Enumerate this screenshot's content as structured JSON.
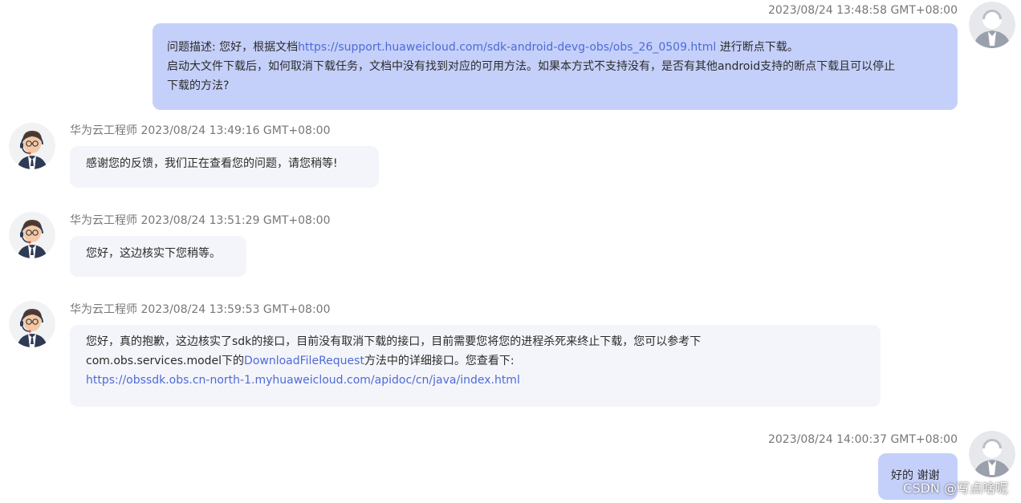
{
  "messages": [
    {
      "sender": "user",
      "time": "2023/08/24 13:48:58 GMT+08:00",
      "line1_prefix": "问题描述: 您好，根据文档",
      "line1_link": "https://support.huaweicloud.com/sdk-android-devg-obs/obs_26_0509.html",
      "line1_suffix": " 进行断点下载。",
      "line2": "启动大文件下载后，如何取消下载任务，文档中没有找到对应的可用方法。如果本方式不支持没有，是否有其他android支持的断点下载且可以停止",
      "line3": "下载的方法?"
    },
    {
      "sender": "engineer",
      "name": "华为云工程师",
      "time": "2023/08/24 13:49:16 GMT+08:00",
      "text": "感谢您的反馈，我们正在查看您的问题，请您稍等!"
    },
    {
      "sender": "engineer",
      "name": "华为云工程师",
      "time": "2023/08/24 13:51:29 GMT+08:00",
      "text": "您好，这边核实下您稍等。"
    },
    {
      "sender": "engineer",
      "name": "华为云工程师",
      "time": "2023/08/24 13:59:53 GMT+08:00",
      "line1": "您好，真的抱歉，这边核实了sdk的接口，目前没有取消下载的接口，目前需要您将您的进程杀死来终止下载，您可以参考下",
      "line2_prefix": "com.obs.services.model下的",
      "line2_link": "DownloadFileRequest",
      "line2_suffix": "方法中的详细接口。您查看下:",
      "line3_link": "https://obssdk.obs.cn-north-1.myhuaweicloud.com/apidoc/cn/java/index.html"
    },
    {
      "sender": "user",
      "time": "2023/08/24 14:00:37 GMT+08:00",
      "text": "好的 谢谢"
    }
  ],
  "watermark": "CSDN @写点啥呢",
  "colors": {
    "user_bubble": "#c5d0fa",
    "engineer_bubble": "#f4f5fa",
    "link": "#4d6bd6",
    "meta_text": "#777777"
  },
  "icons": {
    "user_avatar": "user-silhouette-avatar-icon",
    "engineer_avatar": "support-engineer-headset-avatar-icon"
  }
}
